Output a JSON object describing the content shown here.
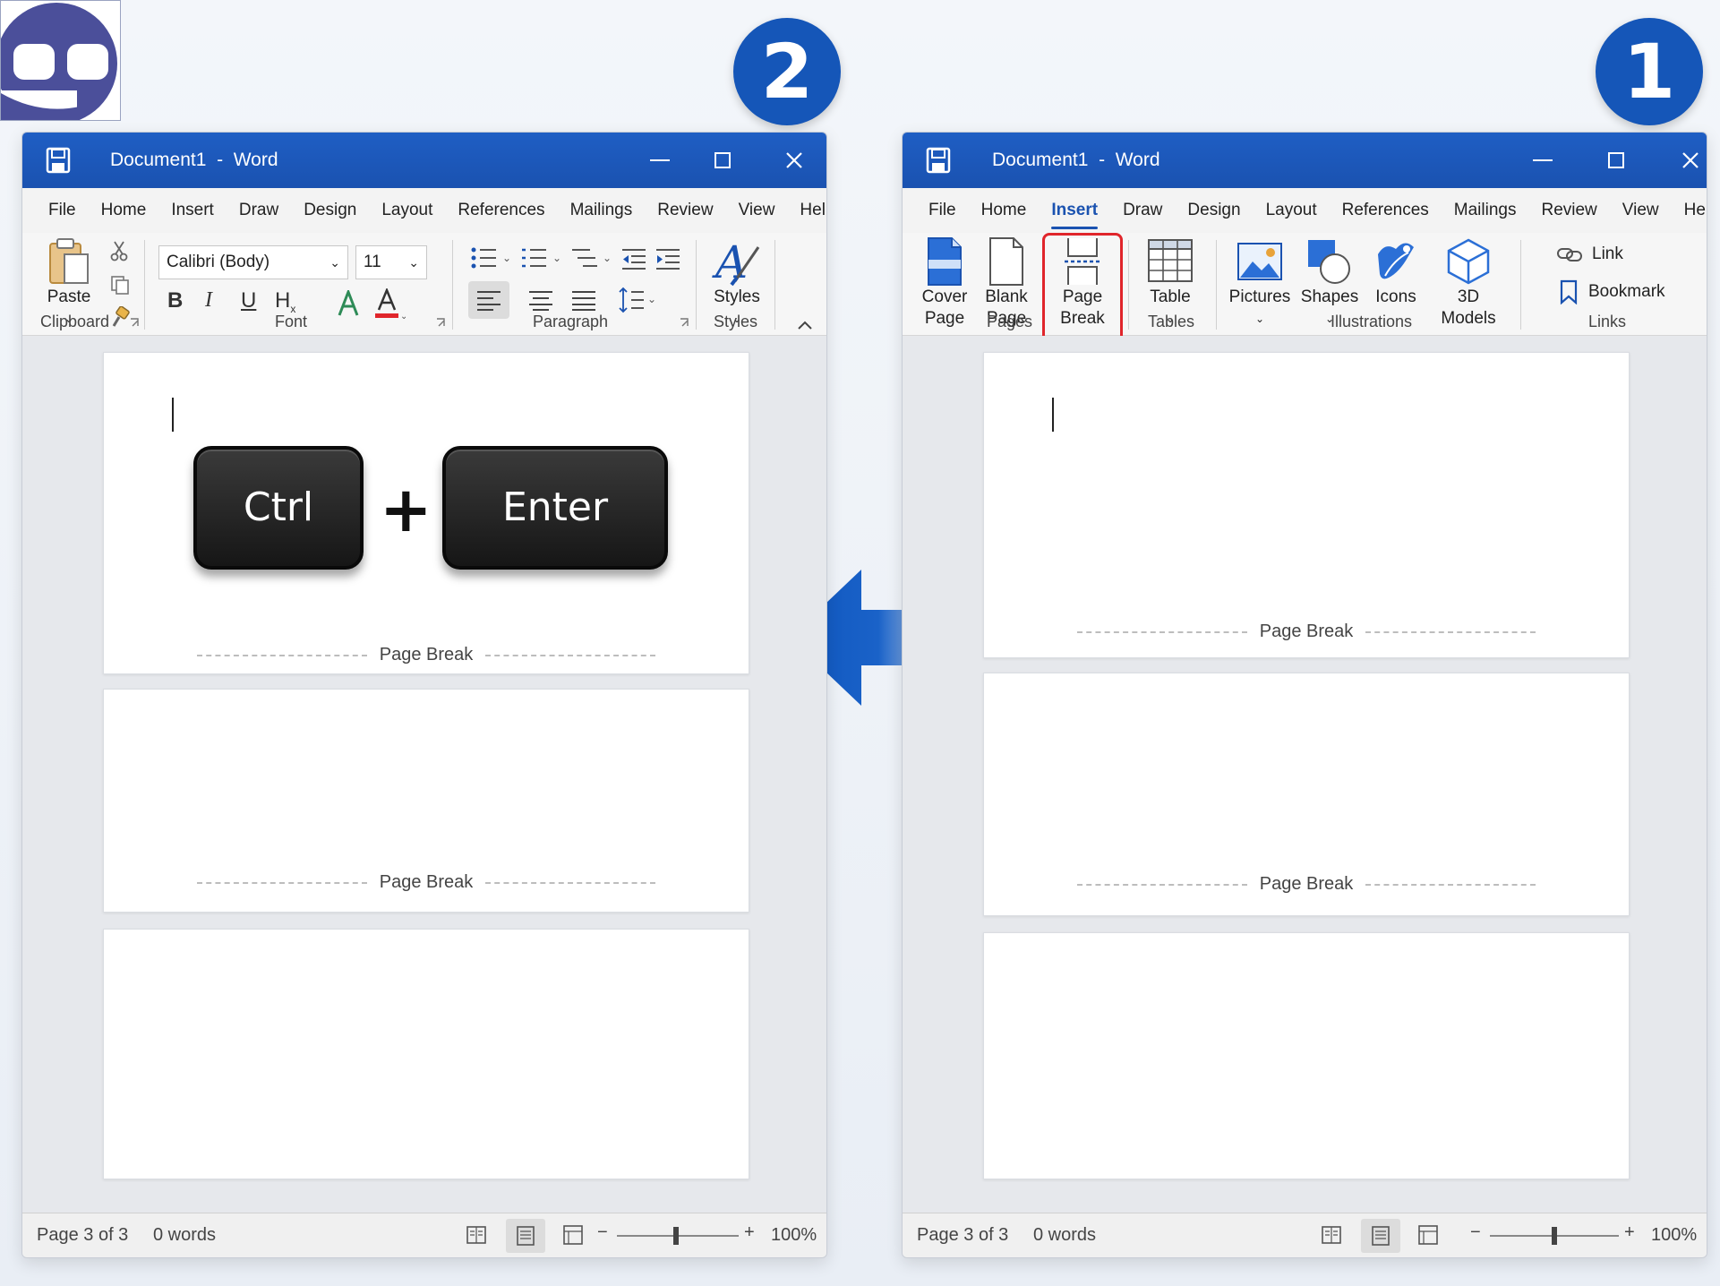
{
  "badges": {
    "left": "2",
    "right": "1"
  },
  "left_window": {
    "doc_title": "Document1",
    "separator": "-",
    "app_name": "Word",
    "menu": [
      "File",
      "Home",
      "Insert",
      "Draw",
      "Design",
      "Layout",
      "References",
      "Mailings",
      "Review",
      "View",
      "Help"
    ],
    "ribbon": {
      "paste_label": "Paste",
      "clipboard_label": "Clipboard",
      "font_name": "Calibri (Body)",
      "font_size": "11",
      "font_label": "Font",
      "paragraph_label": "Paragraph",
      "styles_button": "Styles",
      "styles_label": "Styles"
    },
    "keys": {
      "ctrl": "Ctrl",
      "plus": "+",
      "enter": "Enter"
    },
    "page_break_label": "Page Break",
    "status": {
      "page": "Page 3 of 3",
      "words": "0 words",
      "zoom_minus": "−",
      "zoom_plus": "+",
      "zoom": "100%"
    }
  },
  "right_window": {
    "doc_title": "Document1",
    "separator": "-",
    "app_name": "Word",
    "menu": [
      "File",
      "Home",
      "Insert",
      "Draw",
      "Design",
      "Layout",
      "References",
      "Mailings",
      "Review",
      "View",
      "Help"
    ],
    "active_menu": "Insert",
    "ribbon": {
      "cover_page": [
        "Cover",
        "Page"
      ],
      "blank_page": [
        "Blank",
        "Page"
      ],
      "page_break": [
        "Page",
        "Break"
      ],
      "pages_label": "Pages",
      "table": "Table",
      "tables_label": "Tables",
      "pictures": "Pictures",
      "shapes": "Shapes",
      "icons": "Icons",
      "models": [
        "3D",
        "Models"
      ],
      "illustrations_label": "Illustrations",
      "link": "Link",
      "bookmark": "Bookmark",
      "links_label": "Links"
    },
    "page_break_label": "Page Break",
    "status": {
      "page": "Page 3 of 3",
      "words": "0 words",
      "zoom_minus": "−",
      "zoom_plus": "+",
      "zoom": "100%"
    }
  },
  "colors": {
    "title_bar": "#1a52b0",
    "arrow": "#0f56bf",
    "highlight": "#e0252b",
    "word_blue": "#2b6fd6"
  }
}
